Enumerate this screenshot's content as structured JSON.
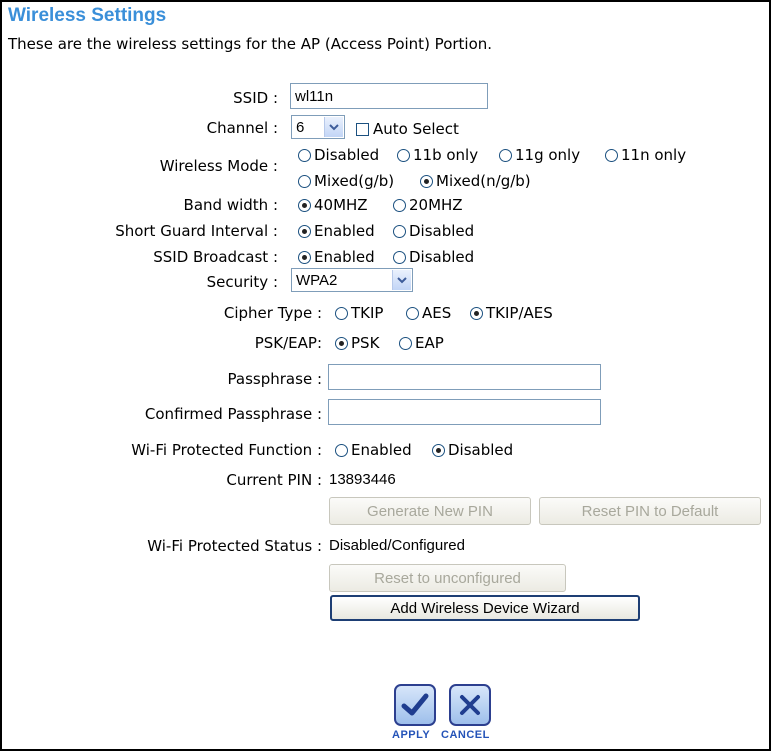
{
  "header": {
    "title": "Wireless Settings",
    "description": "These are the wireless settings for the AP (Access Point) Portion."
  },
  "ssid": {
    "label": "SSID :",
    "value": "wl11n"
  },
  "channel": {
    "label": "Channel :",
    "selected": "6",
    "auto_select_label": "Auto Select",
    "auto_select_checked": false
  },
  "wireless_mode": {
    "label": "Wireless Mode :",
    "options": [
      "Disabled",
      "11b only",
      "11g only",
      "11n only",
      "Mixed(g/b)",
      "Mixed(n/g/b)"
    ],
    "selected": "Mixed(n/g/b)"
  },
  "band_width": {
    "label": "Band width :",
    "options": [
      "40MHZ",
      "20MHZ"
    ],
    "selected": "40MHZ"
  },
  "short_guard_interval": {
    "label": "Short Guard Interval :",
    "options": [
      "Enabled",
      "Disabled"
    ],
    "selected": "Enabled"
  },
  "ssid_broadcast": {
    "label": "SSID Broadcast :",
    "options": [
      "Enabled",
      "Disabled"
    ],
    "selected": "Enabled"
  },
  "security": {
    "label": "Security :",
    "selected": "WPA2"
  },
  "cipher_type": {
    "label": "Cipher Type :",
    "options": [
      "TKIP",
      "AES",
      "TKIP/AES"
    ],
    "selected": "TKIP/AES"
  },
  "psk_eap": {
    "label": "PSK/EAP:",
    "options": [
      "PSK",
      "EAP"
    ],
    "selected": "PSK"
  },
  "passphrase": {
    "label": "Passphrase :",
    "value": ""
  },
  "confirmed_passphrase": {
    "label": "Confirmed Passphrase :",
    "value": ""
  },
  "wps_function": {
    "label": "Wi-Fi Protected Function :",
    "options": [
      "Enabled",
      "Disabled"
    ],
    "selected": "Disabled"
  },
  "current_pin": {
    "label": "Current PIN :",
    "value": "13893446"
  },
  "buttons": {
    "generate_pin": "Generate New PIN",
    "reset_pin": "Reset PIN to Default",
    "reset_unconfigured": "Reset to unconfigured",
    "wizard": "Add Wireless Device Wizard"
  },
  "wps_status": {
    "label": "Wi-Fi Protected Status :",
    "value": "Disabled/Configured"
  },
  "actions": {
    "apply": "APPLY",
    "cancel": "CANCEL"
  },
  "colors": {
    "title": "#3a8fd9",
    "action_label": "#2453b8",
    "radio_border": "#1c5180"
  }
}
